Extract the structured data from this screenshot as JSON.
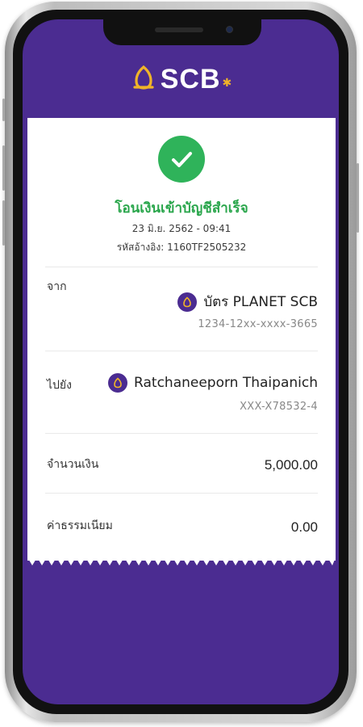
{
  "app": {
    "brand": "SCB"
  },
  "receipt": {
    "title": "โอนเงินเข้าบัญชีสำเร็จ",
    "datetime": "23 มิ.ย. 2562 - 09:41",
    "reference": "รหัสอ้างอิง: 1160TF2505232",
    "from": {
      "label": "จาก",
      "name": "บัตร PLANET SCB",
      "account": "1234-12xx-xxxx-3665"
    },
    "to": {
      "label": "ไปยัง",
      "name": "Ratchaneeporn Thaipanich",
      "account": "XXX-X78532-4"
    },
    "amount": {
      "label": "จำนวนเงิน",
      "value": "5,000.00"
    },
    "fee": {
      "label": "ค่าธรรมเนียม",
      "value": "0.00"
    }
  },
  "colors": {
    "brand_purple": "#4b2c91",
    "success_green": "#2fb35a",
    "logo_gold": "#f0b429"
  },
  "icons": [
    "scb-logo-icon",
    "check-icon",
    "scb-mini-logo-icon"
  ]
}
